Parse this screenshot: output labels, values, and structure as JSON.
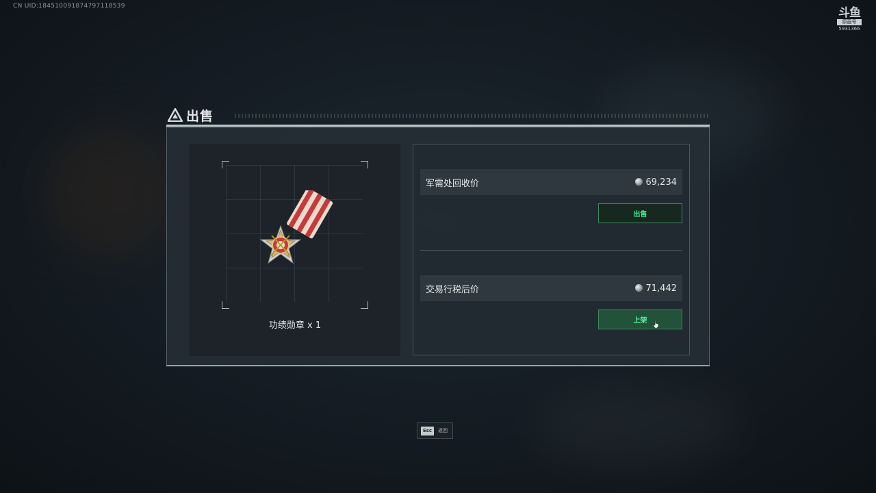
{
  "overlay": {
    "uid": "CN UID:184510091874797118539",
    "logo_mark": "斗鱼",
    "logo_tag": "原画号",
    "logo_room": "5931366"
  },
  "dialog": {
    "title": "出售",
    "item": {
      "name": "功绩勋章 x 1",
      "icon": "medal-icon"
    },
    "options": [
      {
        "label": "军需处回收价",
        "price": "69,234",
        "button_label": "出售"
      },
      {
        "label": "交易行税后价",
        "price": "71,442",
        "button_label": "上架"
      }
    ]
  },
  "footer": {
    "esc_key": "Esc",
    "esc_label": "返回"
  },
  "colors": {
    "accent": "#3fe08a",
    "panel_bg": "#262e36",
    "button_border": "#3f8a60"
  }
}
